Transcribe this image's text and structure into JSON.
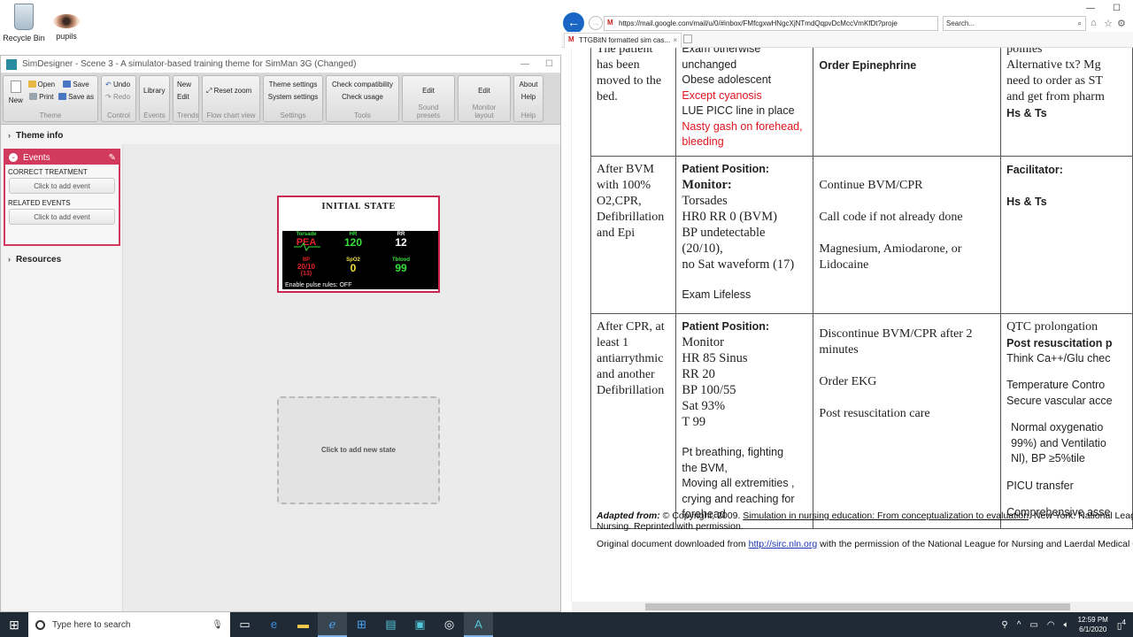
{
  "desktop": {
    "icons": [
      {
        "label": "Recycle Bin"
      },
      {
        "label": "pupils"
      }
    ]
  },
  "simdesigner": {
    "title": "SimDesigner - Scene 3 - A simulator-based training theme for SimMan 3G (Changed)",
    "ribbon": {
      "theme": {
        "new": "New",
        "open": "Open",
        "print": "Print",
        "save": "Save",
        "save_as": "Save as",
        "label": "Theme"
      },
      "control": {
        "undo": "Undo",
        "redo": "Redo",
        "label": "Control"
      },
      "events": {
        "library": "Library",
        "label": "Events"
      },
      "trends": {
        "new": "New",
        "edit": "Edit",
        "label": "Trends"
      },
      "flowchart": {
        "reset_zoom": "Reset zoom",
        "label": "Flow chart view"
      },
      "settings": {
        "theme_settings": "Theme settings",
        "system_settings": "System settings",
        "label": "Settings"
      },
      "tools": {
        "check_compat": "Check compatibility",
        "check_usage": "Check usage",
        "label": "Tools"
      },
      "sound": {
        "edit": "Edit",
        "label": "Sound presets"
      },
      "monitor": {
        "edit": "Edit",
        "label": "Monitor layout"
      },
      "help": {
        "about": "About",
        "help": "Help",
        "label": "Help"
      }
    },
    "theme_info": "Theme info",
    "events_panel": {
      "title": "Events",
      "correct_treatment": "CORRECT TREATMENT",
      "add_event_1": "Click to add event",
      "related_events": "RELATED EVENTS",
      "add_event_2": "Click to add event"
    },
    "resources": "Resources",
    "state": {
      "title": "INITIAL STATE",
      "rhythm_label": "Torsade",
      "rhythm_value": "PEA",
      "hr_label": "HR",
      "hr_value": "120",
      "rr_label": "RR",
      "rr_value": "12",
      "bp_label": "BP",
      "bp_value": "20/10",
      "bp_mean": "(13)",
      "spo2_label": "SpO2",
      "spo2_value": "0",
      "tblood_label": "Tblood",
      "tblood_value": "99",
      "pulse_rules": "Enable pulse rules: OFF"
    },
    "new_state": "Click to add new state"
  },
  "browser": {
    "url": "https://mail.google.com/mail/u/0/#inbox/FMfcgxwHNgcXjNTmdQqpvDcMccVmKfDt?proje",
    "search_placeholder": "Search...",
    "tab_title": "TTGBitN formatted sim cas..."
  },
  "document": {
    "rows": [
      {
        "c1": [
          "The patient",
          "has been",
          "moved to the",
          "bed."
        ],
        "c2_lines": [
          {
            "t": "Exam otherwise",
            "style": "sans"
          },
          {
            "t": "unchanged",
            "style": "sans"
          },
          {
            "t": "Obese adolescent",
            "style": "sans"
          },
          {
            "t": "Except cyanosis",
            "style": "red"
          },
          {
            "t": "LUE PICC line in place",
            "style": "sans"
          },
          {
            "t": "Nasty gash on forehead,",
            "style": "red"
          },
          {
            "t": "bleeding",
            "style": "red"
          }
        ],
        "c3": "Order Epinephrine",
        "c4": [
          "poinies",
          "Alternative tx? Mg",
          "need to order as ST",
          "and get from pharm",
          "",
          "Hs & Ts"
        ]
      },
      {
        "c1": [
          "After BVM",
          "with 100%",
          "O2,CPR,",
          "Defibrillation",
          "and Epi"
        ],
        "c2_head": [
          "Patient Position:",
          "Monitor:"
        ],
        "c2_lines": [
          "Torsades",
          "HR0 RR 0 (BVM)",
          "BP undetectable",
          "(20/10),",
          "no Sat waveform (17)"
        ],
        "c2_tail": "Exam Lifeless",
        "c3": [
          "Continue BVM/CPR",
          "Call code if not already done",
          "Magnesium, Amiodarone, or",
          "Lidocaine"
        ],
        "c4": [
          "Facilitator:",
          "Hs & Ts"
        ]
      },
      {
        "c1": [
          "After CPR, at",
          "least 1",
          "antiarrythmic",
          "and another",
          "Defibrillation"
        ],
        "c2_head": "Patient Position:",
        "c2_lines": [
          "Monitor",
          "HR 85 Sinus",
          "RR 20",
          "BP 100/55",
          "Sat 93%",
          "T 99"
        ],
        "c2_tail": [
          "Pt breathing, fighting",
          "the BVM,",
          "Moving all extremities ,",
          "crying and reaching for",
          "forehead"
        ],
        "c3": [
          "Discontinue BVM/CPR after 2",
          "minutes",
          "Order EKG",
          "Post resuscitation care"
        ],
        "c4": [
          "QTC prolongation",
          "Post resuscitation p",
          "Think Ca++/Glu chec",
          "Temperature Contro",
          "Secure vascular acce",
          "Normal oxygenatio",
          "99%)  and Ventilatio",
          "Nl), BP ≥5%tile",
          "PICU transfer",
          "Comprehensive asse"
        ]
      }
    ],
    "adapted_label": "Adapted from:",
    "adapted_text": " © Copyright, 2009. ",
    "adapted_link": "Simulation in nursing education: From conceptualization to evaluation",
    "adapted_rest": ". New York: National Leag",
    "adapted_line2": "Nursing. Reprinted with permission.",
    "original_text": "Original document downloaded from ",
    "original_link": "http://sirc.nln.org",
    "original_rest": " with the permission of the National League for Nursing and Laerdal Medical C"
  },
  "taskbar": {
    "search_placeholder": "Type here to search",
    "time": "12:59 PM",
    "date": "6/1/2020",
    "notifications": "4"
  },
  "colors": {
    "accent_red": "#d13a5c",
    "monitor_green": "#35e03a",
    "monitor_yellow": "#f3e13a",
    "monitor_red": "#e4222a",
    "link_blue": "#1a36b5"
  }
}
